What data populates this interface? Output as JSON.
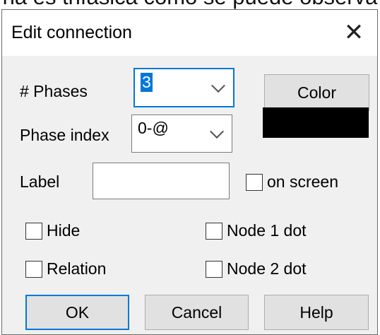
{
  "background_text": "na es trifásica como se puede observa",
  "dialog": {
    "title": "Edit connection",
    "close_glyph": "✕",
    "phases": {
      "label": "# Phases",
      "value": "3"
    },
    "phase_index": {
      "label": "Phase index",
      "value": "0-@"
    },
    "color_button": "Color",
    "color_swatch": "#000000",
    "label_field": {
      "label": "Label",
      "value": ""
    },
    "on_screen": {
      "label": "on screen",
      "checked": false
    },
    "hide": {
      "label": "Hide",
      "checked": false
    },
    "node1dot": {
      "label": "Node 1 dot",
      "checked": false
    },
    "relation": {
      "label": "Relation",
      "checked": false
    },
    "node2dot": {
      "label": "Node 2 dot",
      "checked": false
    },
    "buttons": {
      "ok": "OK",
      "cancel": "Cancel",
      "help": "Help"
    }
  }
}
